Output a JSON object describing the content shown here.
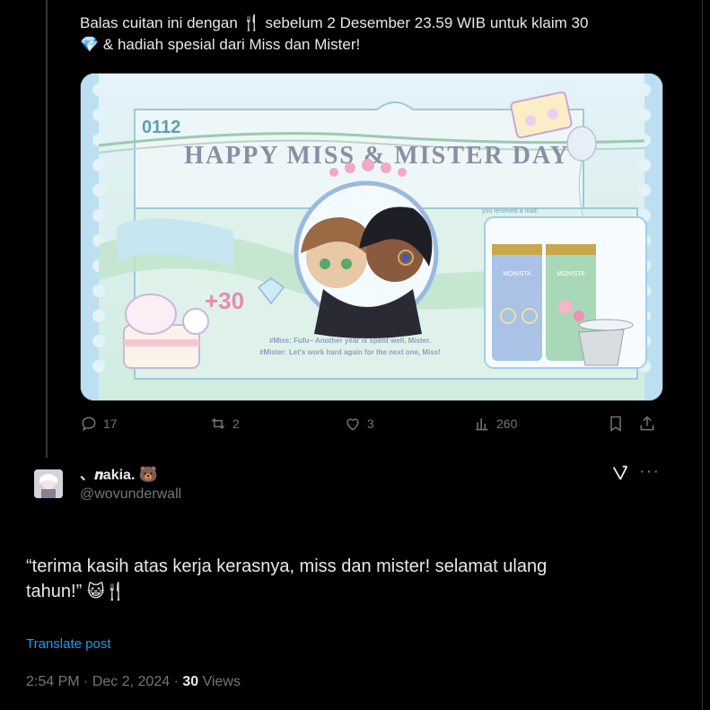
{
  "tweet": {
    "text_part1": "Balas cuitan ini dengan",
    "text_part2": "sebelum 2 Desember 23.59 WIB untuk klaim 30",
    "text_part3": "& hadiah spesial dari Miss dan Mister!",
    "emoji_fork": "🍴",
    "emoji_gem": "💎"
  },
  "media": {
    "date_code": "0112",
    "title": "HAPPY MISS & MISTER DAY",
    "plus_label": "+30",
    "mail_label": "you received a mail!",
    "quote_line1": "#Miss: Fufu~ Another year is spent well, Mister.",
    "quote_line2": "#Mister: Let's work hard again for the next one, Miss!",
    "brand": "MONISTA",
    "colors": {
      "mint": "#cdeede",
      "sky": "#d9eef8",
      "ribbon": "#bfe3c8",
      "title": "#8a8fa5"
    }
  },
  "actions": {
    "reply_count": "17",
    "repost_count": "2",
    "like_count": "3",
    "view_count": "260"
  },
  "reply": {
    "display_name": "、𝒏akia.",
    "name_emoji": "🐻",
    "handle": "@wovunderwall",
    "text_line1": "“terima kasih atas kerja kerasnya, miss dan mister! selamat ulang",
    "text_line2": "tahun!”",
    "text_emojis": "😺🍴",
    "translate_label": "Translate post",
    "time": "2:54 PM",
    "date": "Dec 2, 2024",
    "views_count": "30",
    "views_label": "Views",
    "separator": "·"
  }
}
